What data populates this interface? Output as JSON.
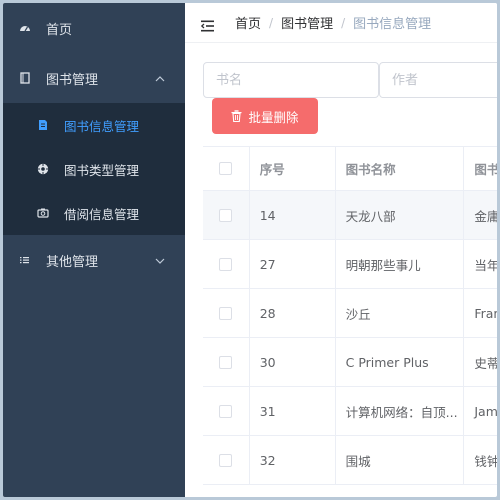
{
  "sidebar": {
    "home": "首页",
    "book_mgmt": "图书管理",
    "sub_items": [
      {
        "label": "图书信息管理",
        "icon": "document-icon"
      },
      {
        "label": "图书类型管理",
        "icon": "compass-icon"
      },
      {
        "label": "借阅信息管理",
        "icon": "camera-icon"
      }
    ],
    "other_mgmt": "其他管理"
  },
  "header": {
    "breadcrumbs": [
      "首页",
      "图书管理",
      "图书信息管理"
    ],
    "separator": "/"
  },
  "search": {
    "book_placeholder": "书名",
    "author_placeholder": "作者"
  },
  "toolbar": {
    "batch_delete_label": "批量删除"
  },
  "table": {
    "columns": [
      "序号",
      "图书名称",
      "图书"
    ],
    "rows": [
      {
        "no": "14",
        "name": "天龙八部",
        "author": "金庸"
      },
      {
        "no": "27",
        "name": "明朝那些事儿",
        "author": "当年"
      },
      {
        "no": "28",
        "name": "沙丘",
        "author": "Fran"
      },
      {
        "no": "30",
        "name": "C Primer Plus",
        "author": "史蒂"
      },
      {
        "no": "31",
        "name": "计算机网络：自顶...",
        "author": "Jam"
      },
      {
        "no": "32",
        "name": "围城",
        "author": "钱钟"
      }
    ]
  },
  "colors": {
    "sidebar_bg": "#304156",
    "submenu_bg": "#1f2d3d",
    "active": "#409eff",
    "danger": "#f56c6c"
  }
}
